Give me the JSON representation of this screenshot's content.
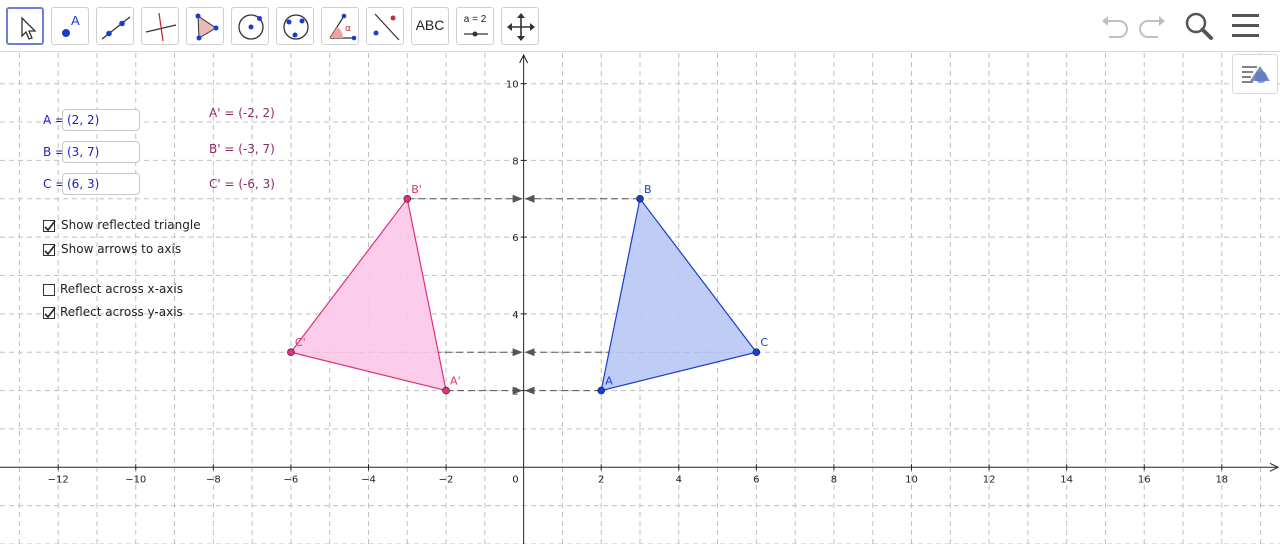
{
  "toolbar": {
    "tools": [
      {
        "id": "move",
        "icon": "cursor-arrow-icon"
      },
      {
        "id": "point",
        "icon": "point-icon",
        "label": "A"
      },
      {
        "id": "line",
        "icon": "line-through-points-icon"
      },
      {
        "id": "perpendicular",
        "icon": "perpendicular-line-icon"
      },
      {
        "id": "polygon",
        "icon": "polygon-icon"
      },
      {
        "id": "circle",
        "icon": "circle-center-point-icon"
      },
      {
        "id": "circle3",
        "icon": "circle-three-points-icon"
      },
      {
        "id": "angle",
        "icon": "angle-icon"
      },
      {
        "id": "reflect",
        "icon": "reflect-about-line-icon"
      },
      {
        "id": "text",
        "icon": "text-icon",
        "label": "ABC"
      },
      {
        "id": "slider",
        "icon": "slider-icon",
        "label": "a = 2"
      },
      {
        "id": "move-view",
        "icon": "move-graphics-view-icon"
      }
    ],
    "right": [
      "undo-icon",
      "redo-icon",
      "search-icon",
      "menu-icon"
    ]
  },
  "inputs": [
    {
      "label": "A =",
      "value": "(2, 2)"
    },
    {
      "label": "B =",
      "value": "(3, 7)"
    },
    {
      "label": "C =",
      "value": "(6, 3)"
    }
  ],
  "reflected_text": [
    "A' = (-2, 2)",
    "B' = (-3, 7)",
    "C' = (-6, 3)"
  ],
  "checkboxes": [
    {
      "label": "Show reflected triangle",
      "checked": true
    },
    {
      "label": "Show arrows to axis",
      "checked": true
    },
    {
      "label": "Reflect across x-axis",
      "checked": false
    },
    {
      "label": "Reflect across y-axis",
      "checked": true
    }
  ],
  "graph": {
    "x_range": [
      -13.5,
      19.5
    ],
    "y_range": [
      -2,
      10.8
    ],
    "x_ticks": [
      -12,
      -10,
      -8,
      -6,
      -4,
      -2,
      2,
      4,
      6,
      8,
      10,
      12,
      14,
      16,
      18
    ],
    "y_ticks": [
      2,
      4,
      6,
      8,
      10
    ],
    "x_tick_labels": [
      "−12",
      "−10",
      "−8",
      "−6",
      "−4",
      "−2",
      "2",
      "4",
      "6",
      "8",
      "10",
      "12",
      "14",
      "16",
      "18"
    ],
    "y_tick_labels": [
      "2",
      "4",
      "6",
      "8",
      "10"
    ],
    "origin_label": "0",
    "grid": true,
    "original_triangle": {
      "color": "#1a3ccc",
      "fill": "#b8c6f5",
      "points": [
        {
          "name": "A",
          "x": 2,
          "y": 2
        },
        {
          "name": "B",
          "x": 3,
          "y": 7
        },
        {
          "name": "C",
          "x": 6,
          "y": 3
        }
      ]
    },
    "reflected_triangle": {
      "color": "#e0307a",
      "fill": "#fcc8e8",
      "points": [
        {
          "name": "A'",
          "x": -2,
          "y": 2
        },
        {
          "name": "B'",
          "x": -3,
          "y": 7
        },
        {
          "name": "C'",
          "x": -6,
          "y": 3
        }
      ]
    },
    "arrow_rows_y": [
      7,
      3,
      2
    ]
  }
}
